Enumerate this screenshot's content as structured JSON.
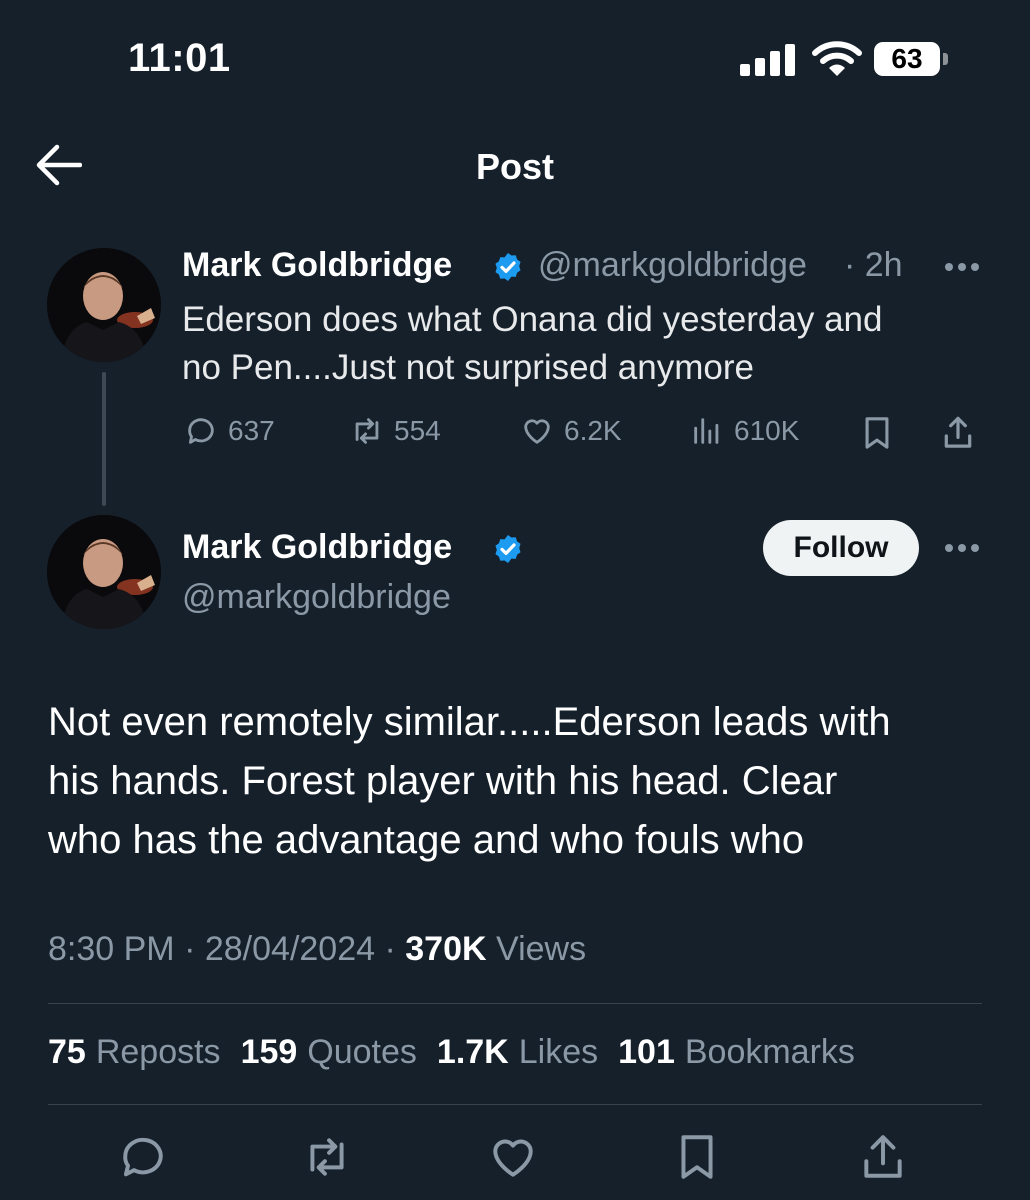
{
  "status_bar": {
    "time": "11:01",
    "battery": "63"
  },
  "header": {
    "title": "Post"
  },
  "quoted_post": {
    "author_name": "Mark Goldbridge",
    "handle": "@markgoldbridge",
    "time_ago": "· 2h",
    "text_line1": "Ederson does what Onana did yesterday and",
    "text_line2": "no Pen....Just not surprised anymore",
    "replies": "637",
    "reposts": "554",
    "likes": "6.2K",
    "views": "610K"
  },
  "main_post": {
    "author_name": "Mark Goldbridge",
    "handle": "@markgoldbridge",
    "follow_label": "Follow",
    "text_line1": "Not even remotely similar.....Ederson leads with",
    "text_line2": "his hands. Forest player with his head. Clear",
    "text_line3": "who has the advantage and who fouls who",
    "time": "8:30 PM",
    "date": "28/04/2024",
    "views_count": "370K",
    "views_label": "Views"
  },
  "engagement": {
    "reposts_count": "75",
    "reposts_label": "Reposts",
    "quotes_count": "159",
    "quotes_label": "Quotes",
    "likes_count": "1.7K",
    "likes_label": "Likes",
    "bookmarks_count": "101",
    "bookmarks_label": "Bookmarks"
  },
  "colors": {
    "background": "#15202b",
    "secondary_text": "#8b98a5",
    "verified": "#1d9bf0",
    "divider": "#38444d"
  },
  "icons": [
    "signal-icon",
    "wifi-icon",
    "battery-icon",
    "back-arrow-icon",
    "verified-badge-icon",
    "more-icon",
    "reply-icon",
    "repost-icon",
    "like-icon",
    "views-icon",
    "bookmark-icon",
    "share-icon"
  ]
}
